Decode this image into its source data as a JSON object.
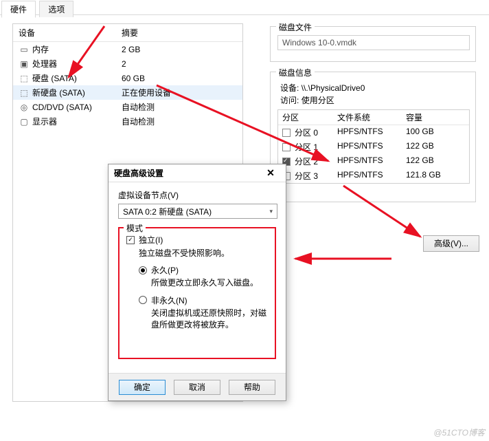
{
  "tabs": {
    "hardware": "硬件",
    "options": "选项"
  },
  "headers": {
    "device": "设备",
    "summary": "摘要"
  },
  "devices": [
    {
      "icon": "memory-icon",
      "name": "内存",
      "summary": "2 GB"
    },
    {
      "icon": "cpu-icon",
      "name": "处理器",
      "summary": "2"
    },
    {
      "icon": "disk-icon",
      "name": "硬盘 (SATA)",
      "summary": "60 GB"
    },
    {
      "icon": "disk-icon",
      "name": "新硬盘 (SATA)",
      "summary": "正在使用设备"
    },
    {
      "icon": "optical-icon",
      "name": "CD/DVD (SATA)",
      "summary": "自动检测"
    },
    {
      "icon": "display-icon",
      "name": "显示器",
      "summary": "自动检测"
    }
  ],
  "disk_file": {
    "title": "磁盘文件",
    "value": "Windows 10-0.vmdk"
  },
  "disk_info": {
    "title": "磁盘信息",
    "dev_label": "设备:",
    "dev_value": "\\\\.\\PhysicalDrive0",
    "acc_label": "访问:",
    "acc_value": "使用分区",
    "cols": {
      "part": "分区",
      "fs": "文件系统",
      "cap": "容量"
    },
    "rows": [
      {
        "checked": false,
        "name": "分区 0",
        "fs": "HPFS/NTFS",
        "cap": "100 GB"
      },
      {
        "checked": false,
        "name": "分区 1",
        "fs": "HPFS/NTFS",
        "cap": "122 GB"
      },
      {
        "checked": true,
        "name": "分区 2",
        "fs": "HPFS/NTFS",
        "cap": "122 GB"
      },
      {
        "checked": false,
        "name": "分区 3",
        "fs": "HPFS/NTFS",
        "cap": "121.8 GB"
      }
    ]
  },
  "adv_btn": "高级(V)...",
  "dialog": {
    "title": "硬盘高级设置",
    "node_label": "虚拟设备节点(V)",
    "node_value": "SATA 0:2  新硬盘 (SATA)",
    "mode_title": "模式",
    "independent": "独立(I)",
    "independent_desc": "独立磁盘不受快照影响。",
    "permanent": "永久(P)",
    "permanent_desc": "所做更改立即永久写入磁盘。",
    "nonpermanent": "非永久(N)",
    "nonpermanent_desc": "关闭虚拟机或还原快照时，对磁盘所做更改将被放弃。",
    "ok": "确定",
    "cancel": "取消",
    "help": "帮助"
  },
  "watermark": "@51CTO博客"
}
